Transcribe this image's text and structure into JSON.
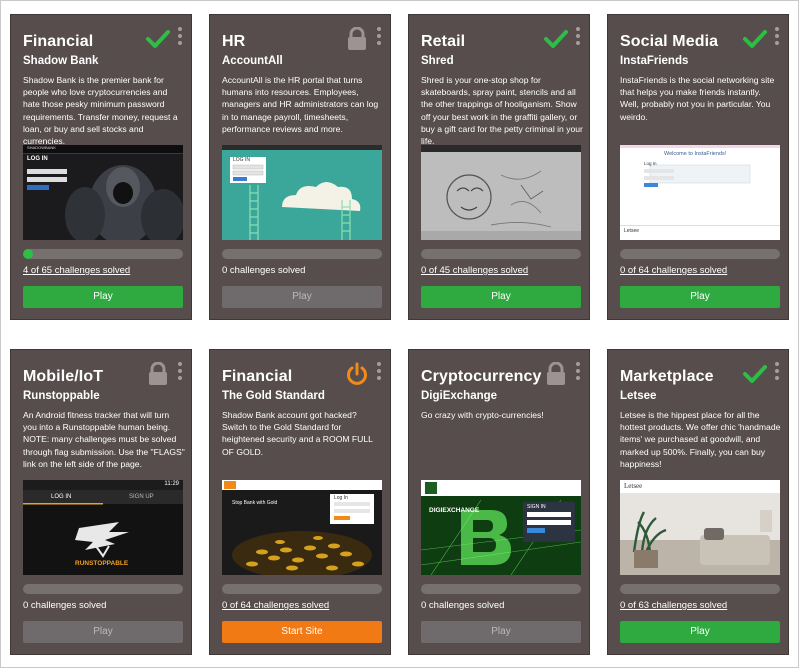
{
  "colors": {
    "card_bg": "#564d4c",
    "play": "#2eaa40",
    "disabled": "#6f6a6c",
    "start": "#f27a14",
    "check": "#2dbe45",
    "lock": "#9e9294",
    "power": "#f28a1a"
  },
  "cards": [
    {
      "category": "Financial",
      "product": "Shadow Bank",
      "description": "Shadow Bank is the premier bank for people who love cryptocurrencies and hate those pesky minimum password requirements. Transfer money, request a loan, or buy and sell stocks and currencies.",
      "status_icon": "check-icon",
      "progress": 0.06,
      "solved": "4 of 65 challenges solved",
      "button": "Play",
      "shot": {
        "login": "LOG IN",
        "brand": "SHADOWBANK"
      }
    },
    {
      "category": "HR",
      "product": "AccountAll",
      "description": "AccountAll is the HR portal that turns humans into resources. Employees, managers and HR administrators can log in to manage payroll, timesheets, performance reviews and more.",
      "status_icon": "lock-icon",
      "progress": 0,
      "solved": "0 challenges solved",
      "button": "Play",
      "shot": {
        "login": "LOG IN"
      }
    },
    {
      "category": "Retail",
      "product": "Shred",
      "description": "Shred is your one-stop shop for skateboards, spray paint, stencils and all the other trappings of hooliganism. Show off your best work in the graffiti gallery, or buy a gift card for the petty criminal in your life.",
      "status_icon": "check-icon",
      "progress": 0,
      "solved": "0 of 45 challenges solved",
      "button": "Play",
      "shot": {}
    },
    {
      "category": "Social Media",
      "product": "InstaFriends",
      "description": "InstaFriends is the social networking site that helps you make friends instantly. Well, probably not you in particular. You weirdo.",
      "status_icon": "check-icon",
      "progress": 0,
      "solved": "0 of 64 challenges solved",
      "button": "Play",
      "shot": {
        "welcome": "Welcome to InstaFriends!",
        "login": "Log In",
        "footer": "Letsee"
      }
    },
    {
      "category": "Mobile/IoT",
      "product": "Runstoppable",
      "description": "An Android fitness tracker that will turn you into a Runstoppable human being. NOTE: many challenges must be solved through flag submission. Use the \"FLAGS\" link on the left side of the page.",
      "status_icon": "lock-icon",
      "progress": 0,
      "solved": "0 challenges solved",
      "button": "Play",
      "shot": {
        "time": "11:29",
        "tab_login": "LOG IN",
        "tab_signup": "SIGN UP",
        "brand": "RUNSTOPPABLE"
      }
    },
    {
      "category": "Financial",
      "product": "The Gold Standard",
      "description": "Shadow Bank account got hacked? Switch to the Gold Standard for heightened security and a ROOM FULL OF GOLD.",
      "status_icon": "power-icon",
      "progress": 0,
      "solved": "0 of 64 challenges solved",
      "button": "Start Site",
      "shot": {
        "headline": "Stop Bank with Gold",
        "login": "Log In"
      }
    },
    {
      "category": "Cryptocurrency",
      "product": "DigiExchange",
      "description": "Go crazy with crypto-currencies!",
      "status_icon": "lock-icon",
      "progress": 0,
      "solved": "0 challenges solved",
      "button": "Play",
      "shot": {
        "brand": "DIGIEXCHANGE",
        "signin": "SIGN IN"
      }
    },
    {
      "category": "Marketplace",
      "product": "Letsee",
      "description": "Letsee is the hippest place for all the hottest products. We offer chic 'handmade items' we purchased at goodwill, and marked up 500%. Finally, you can buy happiness!",
      "status_icon": "check-icon",
      "progress": 0,
      "solved": "0 of 63 challenges solved",
      "button": "Play",
      "shot": {
        "brand": "Letsee"
      }
    }
  ]
}
